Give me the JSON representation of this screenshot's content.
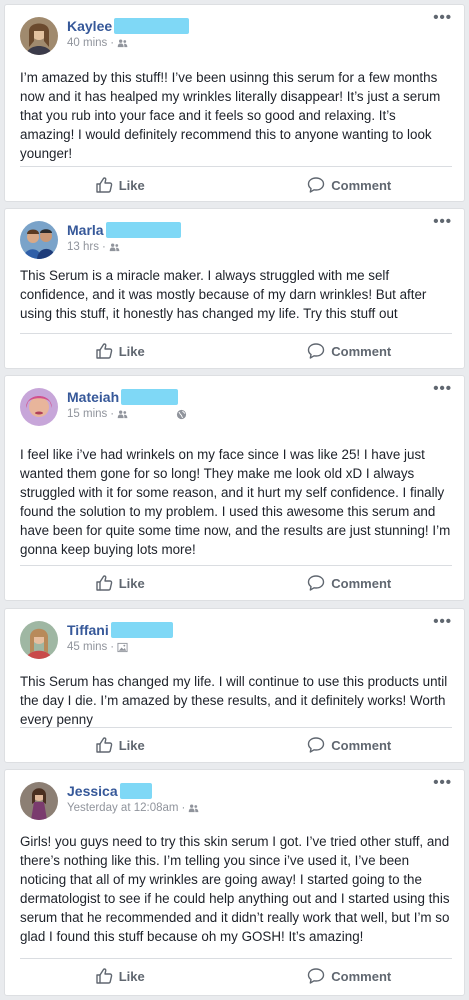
{
  "ui": {
    "like_label": "Like",
    "comment_label": "Comment",
    "more_glyph": "•••",
    "separator": "·"
  },
  "posts": [
    {
      "author": "Kaylee",
      "time": "40 mins",
      "audience_icon": "friends-icon",
      "text": "I’m amazed by this stuff!! I’ve been usinng this serum for a few months now and it has healped my wrinkles literally disappear! It’s just a serum that you rub into your face and it feels so good and relaxing. It’s amazing! I would definitely recommend this to anyone wanting to look younger!"
    },
    {
      "author": "Marla",
      "time": "13 hrs",
      "audience_icon": "friends-icon",
      "text": "This Serum is a miracle maker. I always struggled with me self confidence, and it was mostly because of my darn wrinkles! But after using this stuff, it honestly has changed my life. Try this stuff out"
    },
    {
      "author": "Mateiah",
      "time": "15 mins",
      "audience_icon": "friends-icon",
      "text": "I feel like i’ve had wrinkels on my face since I was like 25! I have just wanted them gone for so long! They make me look old xD I always struggled with it for some reason, and it hurt my self confidence. I finally found the solution to my problem. I used this awesome this serum and have been for quite some time now, and the results are just stunning! I’m gonna keep buying lots more!"
    },
    {
      "author": "Tiffani",
      "time": "45 mins",
      "audience_icon": "public-icon",
      "text": "This Serum has changed my life. I will continue to use this products until the day I die. I’m amazed by these results, and it definitely works! Worth every penny"
    },
    {
      "author": "Jessica",
      "time": "Yesterday at 12:08am",
      "audience_icon": "friends-icon",
      "text": "Girls! you guys need to try this skin serum I got. I’ve tried other stuff, and there’s nothing like this. I’m telling you since i’ve used it, I’ve been noticing that all of my wrinkles are going away! I started going to the dermatologist to see if he could help anything out and I started using this serum that he recommended and it didn’t really work that well, but I’m so glad I found this stuff because oh my GOSH! It’s amazing!"
    }
  ],
  "colors": {
    "page_bg": "#e9ebee",
    "author_blue": "#365899",
    "redaction": "#7fd8f6",
    "muted": "#90949c"
  }
}
